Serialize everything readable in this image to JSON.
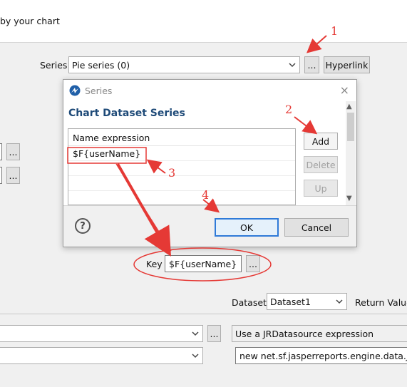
{
  "header": {
    "subtitle": "by your chart"
  },
  "series_row": {
    "label": "Series",
    "selected": "Pie series (0)",
    "browse_label": "...",
    "hyperlink_label": "Hyperlink"
  },
  "left_buttons": {
    "browse1": "...",
    "browse2": "..."
  },
  "dialog": {
    "title": "Series",
    "heading": "Chart Dataset Series",
    "close_glyph": "×",
    "column_header": "Name expression",
    "rows": [
      "$F{userName}"
    ],
    "buttons": {
      "add": "Add",
      "delete": "Delete",
      "up": "Up"
    },
    "help_glyph": "?",
    "ok": "OK",
    "cancel": "Cancel"
  },
  "key_row": {
    "label": "Key",
    "value": "$F{userName}",
    "browse": "..."
  },
  "dataset_row": {
    "label": "Dataset",
    "selected": "Dataset1",
    "return_label": "Return Value"
  },
  "lower": {
    "browse": "...",
    "datasource_label": "Use a JRDatasource expression",
    "expression": "new net.sf.jasperreports.engine.data.JRBe"
  },
  "annotations": {
    "n1": "1",
    "n2": "2",
    "n3": "3",
    "n4": "4",
    "color": "#e53935"
  },
  "icons": [
    "chevron-down-icon",
    "jaspersoft-logo-icon",
    "close-icon",
    "help-icon",
    "scroll-up-icon",
    "scroll-down-icon"
  ]
}
